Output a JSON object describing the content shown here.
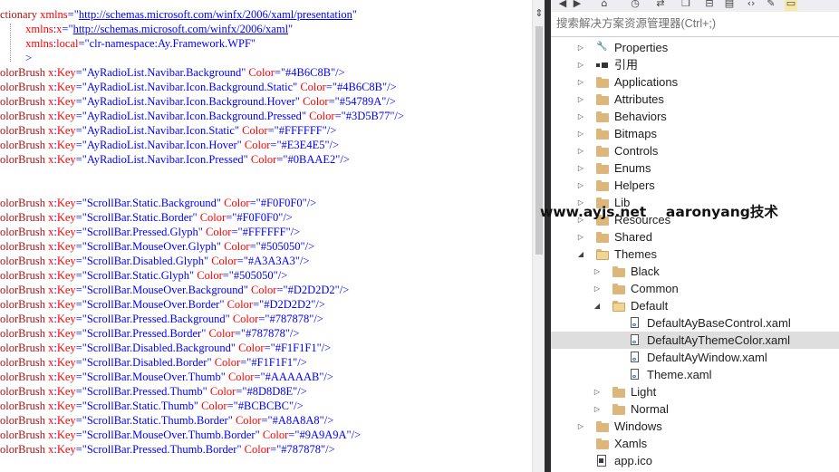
{
  "editor": {
    "lines": [
      [
        {
          "t": "ctionary ",
          "c": "tag"
        },
        {
          "t": "xmlns",
          "c": "attr"
        },
        {
          "t": "=\"",
          "c": "pun"
        },
        {
          "t": "http://schemas.microsoft.com/winfx/2006/xaml/presentation",
          "c": "url"
        },
        {
          "t": "\"",
          "c": "pun"
        }
      ],
      [
        {
          "t": "         ",
          "c": "pun"
        },
        {
          "t": "xmlns",
          "c": "attr"
        },
        {
          "t": ":",
          "c": "pun"
        },
        {
          "t": "x",
          "c": "attr"
        },
        {
          "t": "=\"",
          "c": "pun"
        },
        {
          "t": "http://schemas.microsoft.com/winfx/2006/xaml",
          "c": "url"
        },
        {
          "t": "\"",
          "c": "pun"
        }
      ],
      [
        {
          "t": "         ",
          "c": "pun"
        },
        {
          "t": "xmlns",
          "c": "attr"
        },
        {
          "t": ":",
          "c": "pun"
        },
        {
          "t": "local",
          "c": "attr"
        },
        {
          "t": "=\"clr-namespace:Ay.Framework.WPF\"",
          "c": "str"
        }
      ],
      [
        {
          "t": "         >",
          "c": "pun"
        }
      ],
      [
        {
          "t": "olorBrush ",
          "c": "tag"
        },
        {
          "t": "x",
          "c": "attr"
        },
        {
          "t": ":",
          "c": "pun"
        },
        {
          "t": "Key",
          "c": "attr"
        },
        {
          "t": "=\"AyRadioList.Navibar.Background\" ",
          "c": "str"
        },
        {
          "t": "Color",
          "c": "attr"
        },
        {
          "t": "=\"#4B6C8B\"/>",
          "c": "str"
        }
      ],
      [
        {
          "t": "olorBrush ",
          "c": "tag"
        },
        {
          "t": "x",
          "c": "attr"
        },
        {
          "t": ":",
          "c": "pun"
        },
        {
          "t": "Key",
          "c": "attr"
        },
        {
          "t": "=\"AyRadioList.Navibar.Icon.Background.Static\" ",
          "c": "str"
        },
        {
          "t": "Color",
          "c": "attr"
        },
        {
          "t": "=\"#4B6C8B\"/>",
          "c": "str"
        }
      ],
      [
        {
          "t": "olorBrush ",
          "c": "tag"
        },
        {
          "t": "x",
          "c": "attr"
        },
        {
          "t": ":",
          "c": "pun"
        },
        {
          "t": "Key",
          "c": "attr"
        },
        {
          "t": "=\"AyRadioList.Navibar.Icon.Background.Hover\" ",
          "c": "str"
        },
        {
          "t": "Color",
          "c": "attr"
        },
        {
          "t": "=\"#54789A\"/>",
          "c": "str"
        }
      ],
      [
        {
          "t": "olorBrush ",
          "c": "tag"
        },
        {
          "t": "x",
          "c": "attr"
        },
        {
          "t": ":",
          "c": "pun"
        },
        {
          "t": "Key",
          "c": "attr"
        },
        {
          "t": "=\"AyRadioList.Navibar.Icon.Background.Pressed\" ",
          "c": "str"
        },
        {
          "t": "Color",
          "c": "attr"
        },
        {
          "t": "=\"#3D5B77\"/>",
          "c": "str"
        }
      ],
      [
        {
          "t": "olorBrush ",
          "c": "tag"
        },
        {
          "t": "x",
          "c": "attr"
        },
        {
          "t": ":",
          "c": "pun"
        },
        {
          "t": "Key",
          "c": "attr"
        },
        {
          "t": "=\"AyRadioList.Navibar.Icon.Static\" ",
          "c": "str"
        },
        {
          "t": "Color",
          "c": "attr"
        },
        {
          "t": "=\"#FFFFFF\"/>",
          "c": "str"
        }
      ],
      [
        {
          "t": "olorBrush ",
          "c": "tag"
        },
        {
          "t": "x",
          "c": "attr"
        },
        {
          "t": ":",
          "c": "pun"
        },
        {
          "t": "Key",
          "c": "attr"
        },
        {
          "t": "=\"AyRadioList.Navibar.Icon.Hover\" ",
          "c": "str"
        },
        {
          "t": "Color",
          "c": "attr"
        },
        {
          "t": "=\"#E3E4E5\"/>",
          "c": "str"
        }
      ],
      [
        {
          "t": "olorBrush ",
          "c": "tag"
        },
        {
          "t": "x",
          "c": "attr"
        },
        {
          "t": ":",
          "c": "pun"
        },
        {
          "t": "Key",
          "c": "attr"
        },
        {
          "t": "=\"AyRadioList.Navibar.Icon.Pressed\" ",
          "c": "str"
        },
        {
          "t": "Color",
          "c": "attr"
        },
        {
          "t": "=\"#0BAAE2\"/>",
          "c": "str"
        }
      ],
      [],
      [],
      [
        {
          "t": "olorBrush ",
          "c": "tag"
        },
        {
          "t": "x",
          "c": "attr"
        },
        {
          "t": ":",
          "c": "pun"
        },
        {
          "t": "Key",
          "c": "attr"
        },
        {
          "t": "=\"ScrollBar.Static.Background\" ",
          "c": "str"
        },
        {
          "t": "Color",
          "c": "attr"
        },
        {
          "t": "=\"#F0F0F0\"/>",
          "c": "str"
        }
      ],
      [
        {
          "t": "olorBrush ",
          "c": "tag"
        },
        {
          "t": "x",
          "c": "attr"
        },
        {
          "t": ":",
          "c": "pun"
        },
        {
          "t": "Key",
          "c": "attr"
        },
        {
          "t": "=\"ScrollBar.Static.Border\" ",
          "c": "str"
        },
        {
          "t": "Color",
          "c": "attr"
        },
        {
          "t": "=\"#F0F0F0\"/>",
          "c": "str"
        }
      ],
      [
        {
          "t": "olorBrush ",
          "c": "tag"
        },
        {
          "t": "x",
          "c": "attr"
        },
        {
          "t": ":",
          "c": "pun"
        },
        {
          "t": "Key",
          "c": "attr"
        },
        {
          "t": "=\"ScrollBar.Pressed.Glyph\" ",
          "c": "str"
        },
        {
          "t": "Color",
          "c": "attr"
        },
        {
          "t": "=\"#FFFFFF\"/>",
          "c": "str"
        }
      ],
      [
        {
          "t": "olorBrush ",
          "c": "tag"
        },
        {
          "t": "x",
          "c": "attr"
        },
        {
          "t": ":",
          "c": "pun"
        },
        {
          "t": "Key",
          "c": "attr"
        },
        {
          "t": "=\"ScrollBar.MouseOver.Glyph\" ",
          "c": "str"
        },
        {
          "t": "Color",
          "c": "attr"
        },
        {
          "t": "=\"#505050\"/>",
          "c": "str"
        }
      ],
      [
        {
          "t": "olorBrush ",
          "c": "tag"
        },
        {
          "t": "x",
          "c": "attr"
        },
        {
          "t": ":",
          "c": "pun"
        },
        {
          "t": "Key",
          "c": "attr"
        },
        {
          "t": "=\"ScrollBar.Disabled.Glyph\" ",
          "c": "str"
        },
        {
          "t": "Color",
          "c": "attr"
        },
        {
          "t": "=\"#A3A3A3\"/>",
          "c": "str"
        }
      ],
      [
        {
          "t": "olorBrush ",
          "c": "tag"
        },
        {
          "t": "x",
          "c": "attr"
        },
        {
          "t": ":",
          "c": "pun"
        },
        {
          "t": "Key",
          "c": "attr"
        },
        {
          "t": "=\"ScrollBar.Static.Glyph\" ",
          "c": "str"
        },
        {
          "t": "Color",
          "c": "attr"
        },
        {
          "t": "=\"#505050\"/>",
          "c": "str"
        }
      ],
      [
        {
          "t": "olorBrush ",
          "c": "tag"
        },
        {
          "t": "x",
          "c": "attr"
        },
        {
          "t": ":",
          "c": "pun"
        },
        {
          "t": "Key",
          "c": "attr"
        },
        {
          "t": "=\"ScrollBar.MouseOver.Background\" ",
          "c": "str"
        },
        {
          "t": "Color",
          "c": "attr"
        },
        {
          "t": "=\"#D2D2D2\"/>",
          "c": "str"
        }
      ],
      [
        {
          "t": "olorBrush ",
          "c": "tag"
        },
        {
          "t": "x",
          "c": "attr"
        },
        {
          "t": ":",
          "c": "pun"
        },
        {
          "t": "Key",
          "c": "attr"
        },
        {
          "t": "=\"ScrollBar.MouseOver.Border\" ",
          "c": "str"
        },
        {
          "t": "Color",
          "c": "attr"
        },
        {
          "t": "=\"#D2D2D2\"/>",
          "c": "str"
        }
      ],
      [
        {
          "t": "olorBrush ",
          "c": "tag"
        },
        {
          "t": "x",
          "c": "attr"
        },
        {
          "t": ":",
          "c": "pun"
        },
        {
          "t": "Key",
          "c": "attr"
        },
        {
          "t": "=\"ScrollBar.Pressed.Background\" ",
          "c": "str"
        },
        {
          "t": "Color",
          "c": "attr"
        },
        {
          "t": "=\"#787878\"/>",
          "c": "str"
        }
      ],
      [
        {
          "t": "olorBrush ",
          "c": "tag"
        },
        {
          "t": "x",
          "c": "attr"
        },
        {
          "t": ":",
          "c": "pun"
        },
        {
          "t": "Key",
          "c": "attr"
        },
        {
          "t": "=\"ScrollBar.Pressed.Border\" ",
          "c": "str"
        },
        {
          "t": "Color",
          "c": "attr"
        },
        {
          "t": "=\"#787878\"/>",
          "c": "str"
        }
      ],
      [
        {
          "t": "olorBrush ",
          "c": "tag"
        },
        {
          "t": "x",
          "c": "attr"
        },
        {
          "t": ":",
          "c": "pun"
        },
        {
          "t": "Key",
          "c": "attr"
        },
        {
          "t": "=\"ScrollBar.Disabled.Background\" ",
          "c": "str"
        },
        {
          "t": "Color",
          "c": "attr"
        },
        {
          "t": "=\"#F1F1F1\"/>",
          "c": "str"
        }
      ],
      [
        {
          "t": "olorBrush ",
          "c": "tag"
        },
        {
          "t": "x",
          "c": "attr"
        },
        {
          "t": ":",
          "c": "pun"
        },
        {
          "t": "Key",
          "c": "attr"
        },
        {
          "t": "=\"ScrollBar.Disabled.Border\" ",
          "c": "str"
        },
        {
          "t": "Color",
          "c": "attr"
        },
        {
          "t": "=\"#F1F1F1\"/>",
          "c": "str"
        }
      ],
      [
        {
          "t": "olorBrush ",
          "c": "tag"
        },
        {
          "t": "x",
          "c": "attr"
        },
        {
          "t": ":",
          "c": "pun"
        },
        {
          "t": "Key",
          "c": "attr"
        },
        {
          "t": "=\"ScrollBar.MouseOver.Thumb\" ",
          "c": "str"
        },
        {
          "t": "Color",
          "c": "attr"
        },
        {
          "t": "=\"#AAAAAB\"/>",
          "c": "str"
        }
      ],
      [
        {
          "t": "olorBrush ",
          "c": "tag"
        },
        {
          "t": "x",
          "c": "attr"
        },
        {
          "t": ":",
          "c": "pun"
        },
        {
          "t": "Key",
          "c": "attr"
        },
        {
          "t": "=\"ScrollBar.Pressed.Thumb\" ",
          "c": "str"
        },
        {
          "t": "Color",
          "c": "attr"
        },
        {
          "t": "=\"#8D8D8E\"/>",
          "c": "str"
        }
      ],
      [
        {
          "t": "olorBrush ",
          "c": "tag"
        },
        {
          "t": "x",
          "c": "attr"
        },
        {
          "t": ":",
          "c": "pun"
        },
        {
          "t": "Key",
          "c": "attr"
        },
        {
          "t": "=\"ScrollBar.Static.Thumb\" ",
          "c": "str"
        },
        {
          "t": "Color",
          "c": "attr"
        },
        {
          "t": "=\"#BCBCBC\"/>",
          "c": "str"
        }
      ],
      [
        {
          "t": "olorBrush ",
          "c": "tag"
        },
        {
          "t": "x",
          "c": "attr"
        },
        {
          "t": ":",
          "c": "pun"
        },
        {
          "t": "Key",
          "c": "attr"
        },
        {
          "t": "=\"ScrollBar.Static.Thumb.Border\" ",
          "c": "str"
        },
        {
          "t": "Color",
          "c": "attr"
        },
        {
          "t": "=\"#A8A8A8\"/>",
          "c": "str"
        }
      ],
      [
        {
          "t": "olorBrush ",
          "c": "tag"
        },
        {
          "t": "x",
          "c": "attr"
        },
        {
          "t": ":",
          "c": "pun"
        },
        {
          "t": "Key",
          "c": "attr"
        },
        {
          "t": "=\"ScrollBar.MouseOver.Thumb.Border\" ",
          "c": "str"
        },
        {
          "t": "Color",
          "c": "attr"
        },
        {
          "t": "=\"#9A9A9A\"/>",
          "c": "str"
        }
      ],
      [
        {
          "t": "olorBrush ",
          "c": "tag"
        },
        {
          "t": "x",
          "c": "attr"
        },
        {
          "t": ":",
          "c": "pun"
        },
        {
          "t": "Key",
          "c": "attr"
        },
        {
          "t": "=\"ScrollBar.Pressed.Thumb.Border\" ",
          "c": "str"
        },
        {
          "t": "Color",
          "c": "attr"
        },
        {
          "t": "=\"#787878\"/>",
          "c": "str"
        }
      ]
    ]
  },
  "solution_explorer": {
    "search_placeholder": "搜索解决方案资源管理器(Ctrl+;)",
    "tree": [
      {
        "label": "Properties",
        "icon": "wrench-icon",
        "expand": "collapsed",
        "indent": 0,
        "selected": false
      },
      {
        "label": "引用",
        "icon": "references-icon",
        "expand": "collapsed",
        "indent": 0,
        "selected": false
      },
      {
        "label": "Applications",
        "icon": "folder-icon",
        "expand": "collapsed",
        "indent": 0,
        "selected": false
      },
      {
        "label": "Attributes",
        "icon": "folder-icon",
        "expand": "collapsed",
        "indent": 0,
        "selected": false
      },
      {
        "label": "Behaviors",
        "icon": "folder-icon",
        "expand": "collapsed",
        "indent": 0,
        "selected": false
      },
      {
        "label": "Bitmaps",
        "icon": "folder-icon",
        "expand": "collapsed",
        "indent": 0,
        "selected": false
      },
      {
        "label": "Controls",
        "icon": "folder-icon",
        "expand": "collapsed",
        "indent": 0,
        "selected": false
      },
      {
        "label": "Enums",
        "icon": "folder-icon",
        "expand": "collapsed",
        "indent": 0,
        "selected": false
      },
      {
        "label": "Helpers",
        "icon": "folder-icon",
        "expand": "collapsed",
        "indent": 0,
        "selected": false
      },
      {
        "label": "Lib",
        "icon": "folder-icon",
        "expand": "collapsed",
        "indent": 0,
        "selected": false
      },
      {
        "label": "Resources",
        "icon": "folder-icon",
        "expand": "collapsed",
        "indent": 0,
        "selected": false
      },
      {
        "label": "Shared",
        "icon": "folder-icon",
        "expand": "collapsed",
        "indent": 0,
        "selected": false
      },
      {
        "label": "Themes",
        "icon": "folder-open-icon",
        "expand": "expanded",
        "indent": 0,
        "selected": false
      },
      {
        "label": "Black",
        "icon": "folder-icon",
        "expand": "collapsed",
        "indent": 1,
        "selected": false
      },
      {
        "label": "Common",
        "icon": "folder-icon",
        "expand": "collapsed",
        "indent": 1,
        "selected": false
      },
      {
        "label": "Default",
        "icon": "folder-open-icon",
        "expand": "expanded",
        "indent": 1,
        "selected": false
      },
      {
        "label": "DefaultAyBaseControl.xaml",
        "icon": "xaml-file-icon",
        "expand": "none",
        "indent": 2,
        "selected": false
      },
      {
        "label": "DefaultAyThemeColor.xaml",
        "icon": "xaml-file-icon",
        "expand": "none",
        "indent": 2,
        "selected": true
      },
      {
        "label": "DefaultAyWindow.xaml",
        "icon": "xaml-file-icon",
        "expand": "none",
        "indent": 2,
        "selected": false
      },
      {
        "label": "Theme.xaml",
        "icon": "xaml-file-icon",
        "expand": "none",
        "indent": 2,
        "selected": false
      },
      {
        "label": "Light",
        "icon": "folder-icon",
        "expand": "collapsed",
        "indent": 1,
        "selected": false
      },
      {
        "label": "Normal",
        "icon": "folder-icon",
        "expand": "collapsed",
        "indent": 1,
        "selected": false
      },
      {
        "label": "Windows",
        "icon": "folder-icon",
        "expand": "collapsed",
        "indent": 0,
        "selected": false
      },
      {
        "label": "Xamls",
        "icon": "folder-icon",
        "expand": "none",
        "indent": 0,
        "selected": false
      },
      {
        "label": "app.ico",
        "icon": "ico-file-icon",
        "expand": "none",
        "indent": 0,
        "selected": false
      }
    ]
  },
  "watermark": "www.ayjs.net    aaronyang技术",
  "colors": {
    "tag": "#a31515",
    "attr": "#ff0000",
    "string": "#0000ff",
    "selection": "#dedede",
    "folder": "#dcb67a"
  }
}
